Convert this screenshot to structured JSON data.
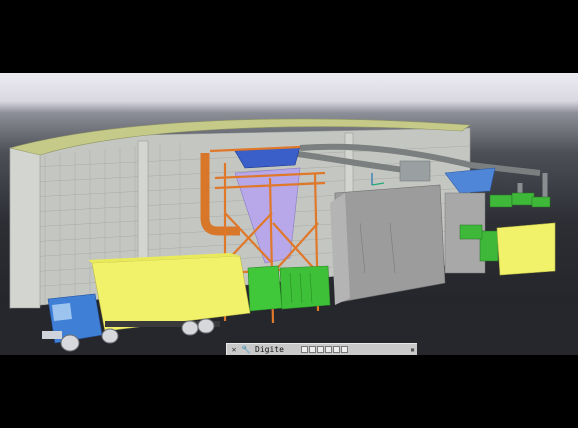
{
  "command_line": {
    "close_icon": "close-icon",
    "settings_icon": "wrench-icon",
    "prompt_text": "Digite",
    "grip_icon": "resize-grip-icon"
  },
  "scene": {
    "description_colors": {
      "building_wall": "#c8cac6",
      "roof": "#c6cb8b",
      "truck_trailer": "#f2f26a",
      "truck_cab": "#3f7fd6",
      "steel_frame": "#e07a23",
      "hopper": "#b7a6e8",
      "containers": "#3fc53a",
      "silo": "#a7a7a7"
    }
  }
}
